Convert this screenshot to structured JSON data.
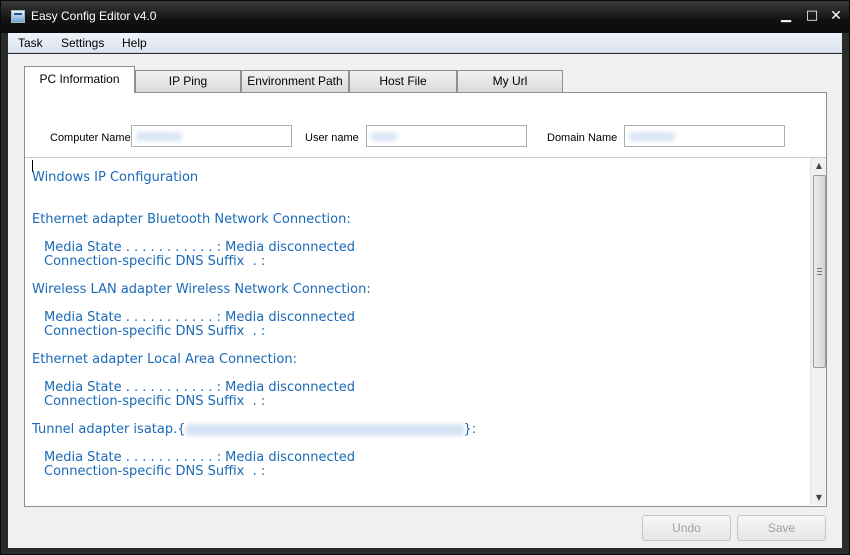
{
  "window": {
    "title": "Easy Config Editor v4.0"
  },
  "titlebar_buttons": {
    "minimize": "▁",
    "maximize": "□",
    "close": "✕"
  },
  "menu": {
    "items": [
      "Task",
      "Settings",
      "Help"
    ]
  },
  "tabs": [
    {
      "label": "PC Information",
      "active": true
    },
    {
      "label": "IP Ping",
      "active": false
    },
    {
      "label": "Environment Path",
      "active": false
    },
    {
      "label": "Host File",
      "active": false
    },
    {
      "label": "My Url",
      "active": false
    }
  ],
  "fields": {
    "computer_name": {
      "label": "Computer Name",
      "value": ""
    },
    "user_name": {
      "label": "User name",
      "value": ""
    },
    "domain_name": {
      "label": "Domain Name",
      "value": ""
    }
  },
  "output": {
    "title": "Windows IP Configuration",
    "adapters": [
      {
        "header": "Ethernet adapter Bluetooth Network Connection:",
        "media_state": "Media State . . . . . . . . . . . : Media disconnected",
        "dns_suffix": "Connection-specific DNS Suffix  . :"
      },
      {
        "header": "Wireless LAN adapter Wireless Network Connection:",
        "media_state": "Media State . . . . . . . . . . . : Media disconnected",
        "dns_suffix": "Connection-specific DNS Suffix  . :"
      },
      {
        "header": "Ethernet adapter Local Area Connection:",
        "media_state": "Media State . . . . . . . . . . . : Media disconnected",
        "dns_suffix": "Connection-specific DNS Suffix  . :"
      },
      {
        "header_prefix": "Tunnel adapter isatap.{",
        "header_suffix": "}:",
        "media_state": "Media State . . . . . . . . . . . : Media disconnected",
        "dns_suffix": "Connection-specific DNS Suffix  . :"
      }
    ]
  },
  "scrollbar": {
    "up_arrow": "▲",
    "down_arrow": "▼"
  },
  "buttons": {
    "undo": "Undo",
    "save": "Save"
  },
  "colors": {
    "output_text": "#1b6ab8",
    "titlebar": "#111111",
    "menubar": "#e3e9f3"
  }
}
